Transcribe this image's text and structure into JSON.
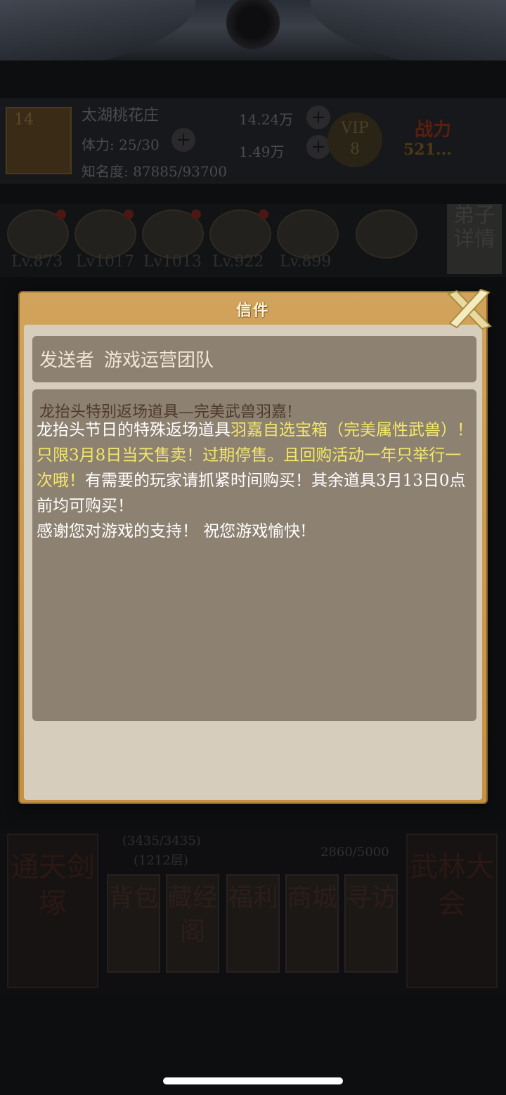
{
  "hud": {
    "level": "14",
    "village_name": "太湖桃花庄",
    "stamina": "体力: 25/30",
    "fame": "知名度: 87885/93700",
    "silver": "14.24万",
    "gold": "1.49万",
    "vip_label": "VIP",
    "vip_level": "8",
    "power_label": "战力",
    "power_value": "521..."
  },
  "disciples": {
    "levels": [
      "Lv.873",
      "Lv1017",
      "Lv1013",
      "Lv.922",
      "Lv.899"
    ],
    "details_tab": "弟子详情"
  },
  "bottom": {
    "tower_label": "通天剑塚",
    "stars": "(3435/3435)",
    "floors": "(1212层)",
    "currency": "2860/5000",
    "tiles": [
      "背包",
      "藏经阁",
      "福利",
      "商城",
      "寻访"
    ],
    "conference": "武林大会"
  },
  "dialog": {
    "title": "信件",
    "sender_label": "发送者",
    "sender_name": "游戏运营团队",
    "subject": "龙抬头特别返场道具—完美武兽羽嘉!",
    "body_part1": "龙抬头节日的特殊返场道具",
    "body_highlight": "羽嘉自选宝箱（完美属性武兽）！只限3月8日当天售卖！过期停售。且回购活动一年只举行一次哦！",
    "body_part2": "有需要的玩家请抓紧时间购买！其余道具3月13日0点前均可购买！",
    "body_part3": "感谢您对游戏的支持！ 祝您游戏愉快!"
  },
  "colors": {
    "dialog_frame": "#c9964c",
    "panel": "#8d8172",
    "highlight": "#f4e86a"
  }
}
